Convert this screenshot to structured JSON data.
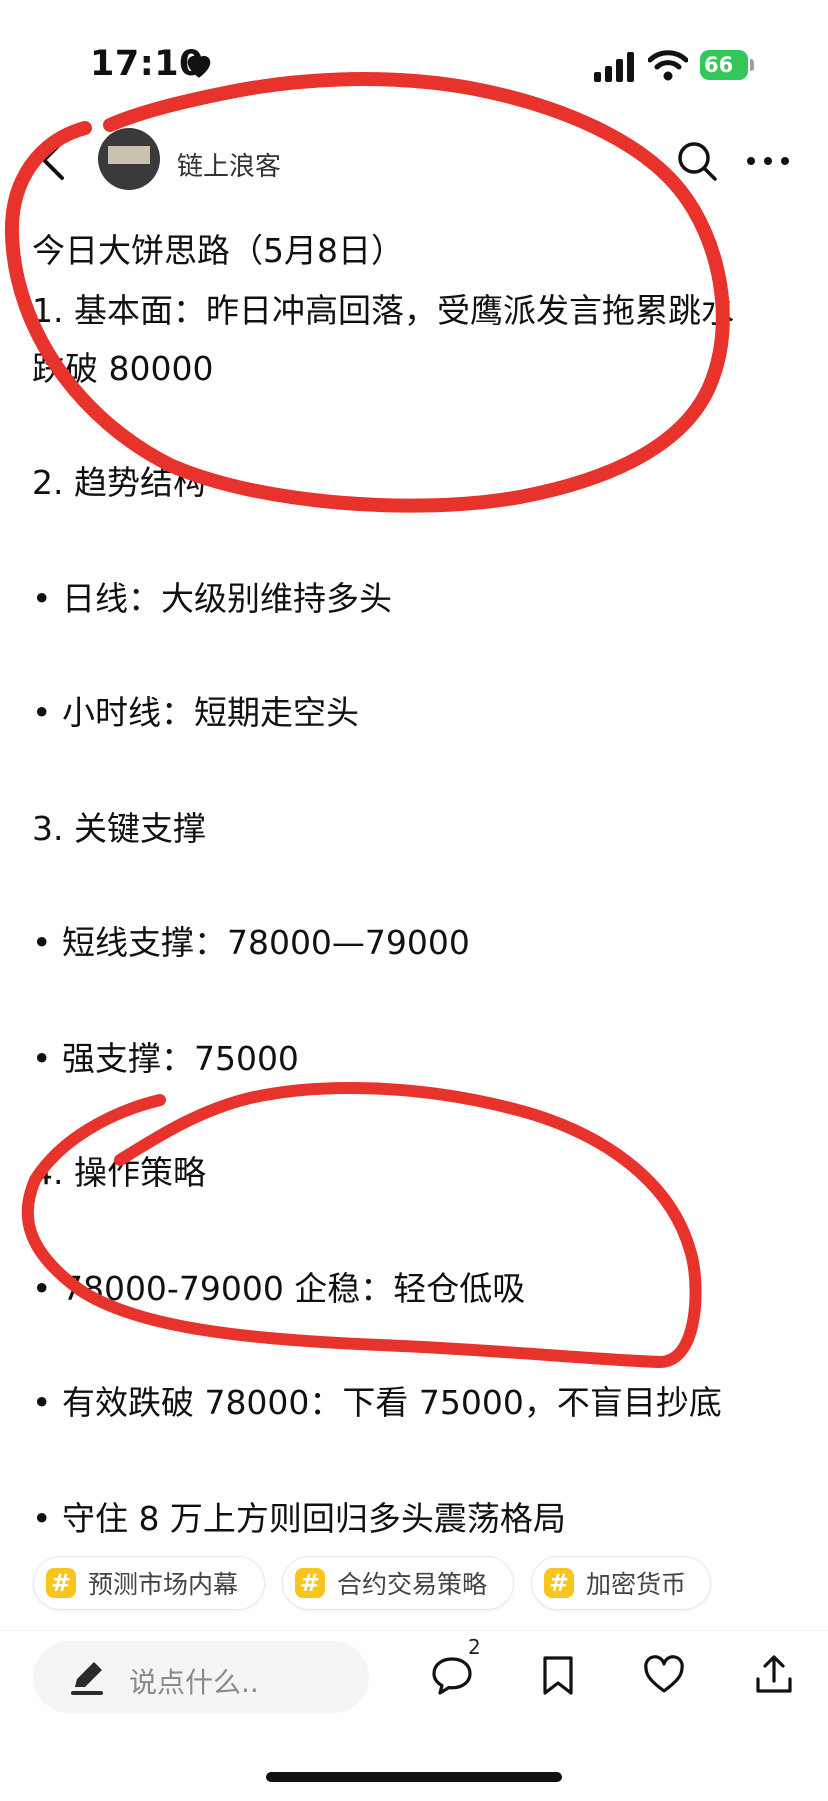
{
  "status": {
    "time": "17:10",
    "battery": "66"
  },
  "header": {
    "author": "链上浪客"
  },
  "post": {
    "lines": [
      "今日大饼思路（5月8日）",
      "1. 基本面：昨日冲高回落，受鹰派发言拖累跳水",
      "跌破 80000",
      "2. 趋势结构",
      "• 日线：大级别维持多头",
      "• 小时线：短期走空头",
      "3. 关键支撑",
      "• 短线支撑：78000—79000",
      "• 强支撑：75000",
      "4. 操作策略",
      "• 78000-79000 企稳：轻仓低吸",
      "• 有效跌破 78000：下看 75000，不盲目抄底",
      "• 守住 8 万上方则回归多头震荡格局"
    ]
  },
  "tags": [
    {
      "hash": "#",
      "label": "预测市场内幕"
    },
    {
      "hash": "#",
      "label": "合约交易策略"
    },
    {
      "hash": "#",
      "label": "加密货币"
    }
  ],
  "bottom": {
    "comment_placeholder": "说点什么..",
    "comment_count": "2"
  },
  "colors": {
    "annotation": "#e8322c",
    "tag_hash": "#f7c51b",
    "battery": "#34c759"
  },
  "icons": [
    "back-icon",
    "search-icon",
    "more-icon",
    "pen-icon",
    "comment-icon",
    "bookmark-icon",
    "heart-icon",
    "share-icon"
  ]
}
